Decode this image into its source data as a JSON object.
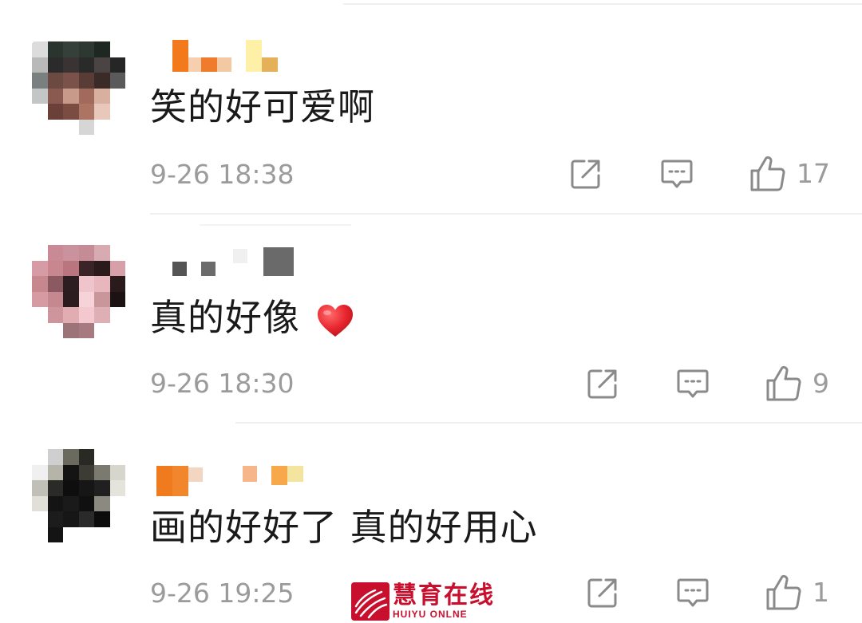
{
  "comments": [
    {
      "text": "笑的好可爱啊",
      "time": "9-26 18:38",
      "likes": "17",
      "has_heart_emoji": false
    },
    {
      "text": "真的好像",
      "time": "9-26 18:30",
      "likes": "9",
      "has_heart_emoji": true
    },
    {
      "text": "画的好好了 真的好用心",
      "time": "9-26 19:25",
      "likes": "1",
      "has_heart_emoji": false
    }
  ],
  "icons": {
    "share": "share-icon",
    "reply": "reply-icon",
    "like": "thumbs-up-icon",
    "heart_emoji": "red-heart-emoji"
  },
  "colors": {
    "text": "#1a1a1a",
    "meta": "#9b9b9b",
    "icon": "#8a8a8a",
    "divider": "#efefef",
    "heart": "#e8262f",
    "watermark": "#c8102e"
  },
  "watermark": {
    "name_cn": "慧育在线",
    "name_en": "HUIYU ONLNE"
  }
}
